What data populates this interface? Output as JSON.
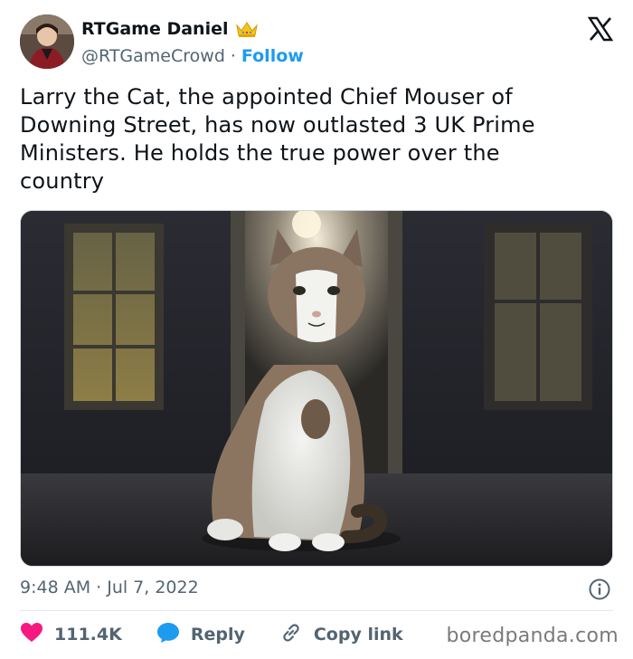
{
  "author": {
    "display_name": "RTGame Daniel",
    "handle": "@RTGameCrowd",
    "separator": "·",
    "follow_label": "Follow",
    "badge_icon": "crown-icon"
  },
  "tweet": {
    "text": "Larry the Cat, the appointed Chief Mouser of\nDowning Street, has now outlasted 3 UK Prime\nMinisters. He holds the true power over the\ncountry",
    "timestamp": "9:48 AM · Jul 7, 2022"
  },
  "actions": {
    "likes": "111.4K",
    "reply_label": "Reply",
    "copy_link_label": "Copy link"
  },
  "watermark": "boredpanda.com",
  "colors": {
    "accent": "#1d9bf0",
    "heart": "#f91880",
    "text": "#0f1419",
    "muted": "#536471"
  }
}
